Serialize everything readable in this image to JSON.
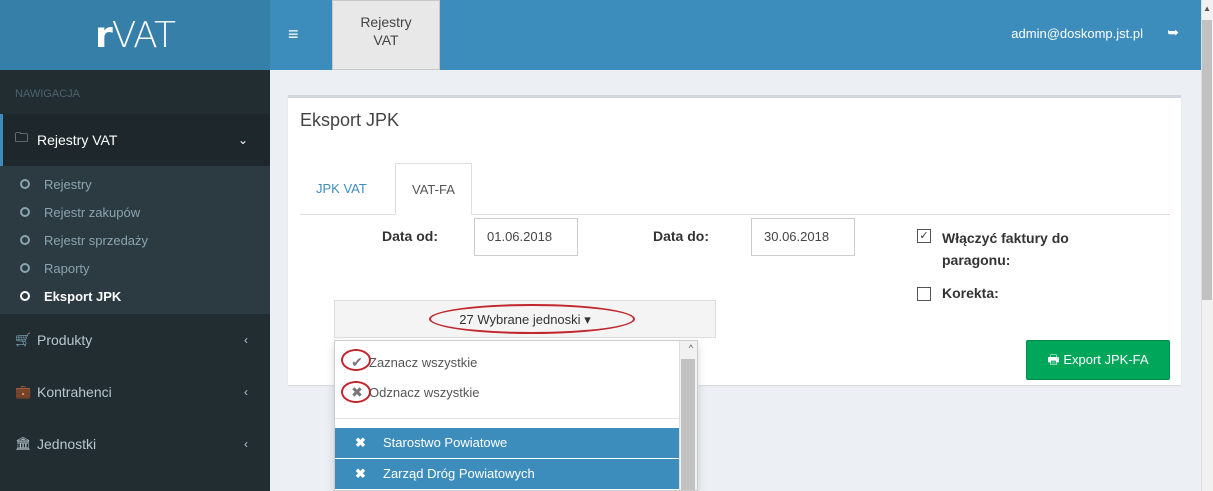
{
  "app": {
    "logo_prefix": "r",
    "logo_text": "VAT"
  },
  "sidebar": {
    "header": "NAWIGACJA",
    "rejestry_label": "Rejestry VAT",
    "submenu": [
      "Rejestry",
      "Rejestr zakupów",
      "Rejestr sprzedaży",
      "Raporty",
      "Eksport JPK"
    ],
    "produkty_label": "Produkty",
    "kontrahenci_label": "Kontrahenci",
    "jednostki_label": "Jednostki"
  },
  "topbar": {
    "tab_line1": "Rejestry",
    "tab_line2": "VAT",
    "user_email": "admin@doskomp.jst.pl"
  },
  "main": {
    "title": "Eksport JPK",
    "tabs": [
      "JPK VAT",
      "VAT-FA"
    ],
    "date_from_label": "Data od:",
    "date_from_value": "01.06.2018",
    "date_to_label": "Data do:",
    "date_to_value": "30.06.2018",
    "include_invoices_label_1": "Włączyć faktury do",
    "include_invoices_label_2": "paragonu:",
    "include_invoices_checked": true,
    "correction_label": "Korekta:",
    "correction_checked": false,
    "units_button": "27 Wybrane jednoski",
    "export_button": "Export JPK-FA"
  },
  "dropdown": {
    "select_all": "Zaznacz wszystkie",
    "deselect_all": "Odznacz wszystkie",
    "options": [
      "Starostwo Powiatowe",
      "Zarząd Dróg Powiatowych"
    ]
  },
  "colors": {
    "header": "#3c8dbc",
    "sidebar": "#222d32",
    "export": "#00a65a",
    "annotation": "#c0262c"
  }
}
